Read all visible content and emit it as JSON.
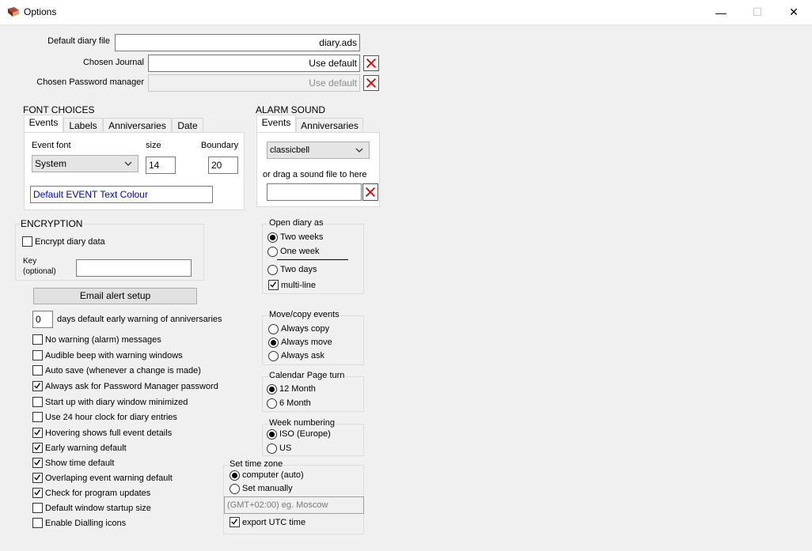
{
  "window": {
    "title": "Options",
    "minimize": "—",
    "maximize": "☐",
    "close": "✕"
  },
  "files": {
    "default_diary_label": "Default diary file",
    "default_diary_value": "diary.ads",
    "chosen_journal_label": "Chosen Journal",
    "chosen_journal_value": "Use default",
    "password_manager_label": "Chosen Password manager",
    "password_manager_value": "Use default"
  },
  "font_choices": {
    "title": "FONT CHOICES",
    "tabs": [
      "Events",
      "Labels",
      "Anniversaries",
      "Date"
    ],
    "event_font_label": "Event font",
    "size_label": "size",
    "boundary_label": "Boundary",
    "font_value": "System",
    "size_value": "14",
    "boundary_value": "20",
    "colour_text": "Default EVENT Text Colour"
  },
  "alarm_sound": {
    "title": "ALARM SOUND",
    "tabs": [
      "Events",
      "Anniversaries"
    ],
    "sound_value": "classicbell",
    "drag_label": "or drag a sound file to here"
  },
  "encryption": {
    "title": "ENCRYPTION",
    "encrypt_label": "Encrypt diary data",
    "key_label_1": "Key",
    "key_label_2": "(optional)"
  },
  "email_button": "Email alert setup",
  "warning_days": {
    "value": "0",
    "label": "days default early warning of anniversaries"
  },
  "options": [
    {
      "label": "No warning (alarm) messages",
      "checked": false
    },
    {
      "label": "Audible beep with warning windows",
      "checked": false
    },
    {
      "label": "Auto save (whenever a change is made)",
      "checked": false
    },
    {
      "label": "Always ask for Password Manager password",
      "checked": true
    },
    {
      "label": "Start up with diary window minimized",
      "checked": false
    },
    {
      "label": "Use 24 hour clock for diary entries",
      "checked": false
    },
    {
      "label": "Hovering shows full event details",
      "checked": true
    },
    {
      "label": "Early warning default",
      "checked": true
    },
    {
      "label": "Show time default",
      "checked": true
    },
    {
      "label": "Overlaping event warning default",
      "checked": true
    },
    {
      "label": "Check for program updates",
      "checked": true
    },
    {
      "label": "Default window startup size",
      "checked": false
    },
    {
      "label": "Enable Dialling icons",
      "checked": false
    }
  ],
  "open_diary": {
    "title": "Open diary as",
    "two_weeks": "Two weeks",
    "one_week": "One week",
    "two_days": "Two days",
    "multi_line": "multi-line"
  },
  "move_copy": {
    "title": "Move/copy events",
    "copy": "Always copy",
    "move": "Always move",
    "ask": "Always ask"
  },
  "calendar_turn": {
    "title": "Calendar Page turn",
    "m12": "12 Month",
    "m6": "6 Month"
  },
  "week_numbering": {
    "title": "Week numbering",
    "iso": "ISO (Europe)",
    "us": "US"
  },
  "time_zone": {
    "title": "Set time zone",
    "auto": "computer (auto)",
    "manual": "Set manually",
    "zone_value": "(GMT+02:00) eg. Moscow",
    "utc": "export UTC time"
  }
}
